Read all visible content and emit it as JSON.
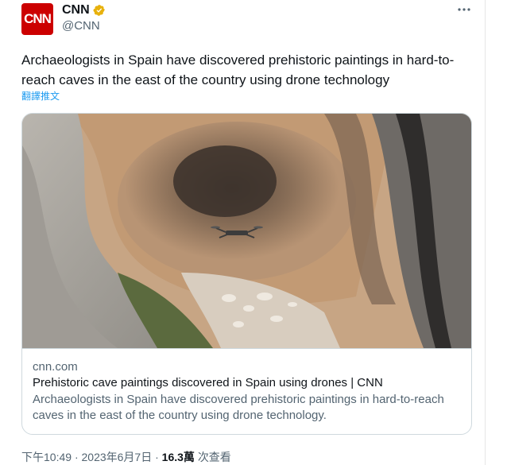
{
  "account": {
    "avatar_text": "CNN",
    "name": "CNN",
    "handle": "@CNN",
    "verified": true,
    "verified_color": "#e8b10c",
    "brand_color": "#cc0000"
  },
  "tweet": {
    "text": "Archaeologists in Spain have discovered prehistoric paintings in hard-to-reach caves in the east of the country using drone technology",
    "translate_label": "翻譯推文"
  },
  "card": {
    "image_icon": "cave-with-drone-photo",
    "domain": "cnn.com",
    "title": "Prehistoric cave paintings discovered in Spain using drones | CNN",
    "description": "Archaeologists in Spain have discovered prehistoric paintings in hard-to-reach caves in the east of the country using drone technology."
  },
  "meta": {
    "time": "下午10:49",
    "date": "2023年6月7日",
    "views_count": "16.3萬",
    "views_label": "次查看",
    "separator": "·"
  },
  "icons": {
    "more": "more-dots-icon",
    "verified": "verified-badge-icon"
  }
}
